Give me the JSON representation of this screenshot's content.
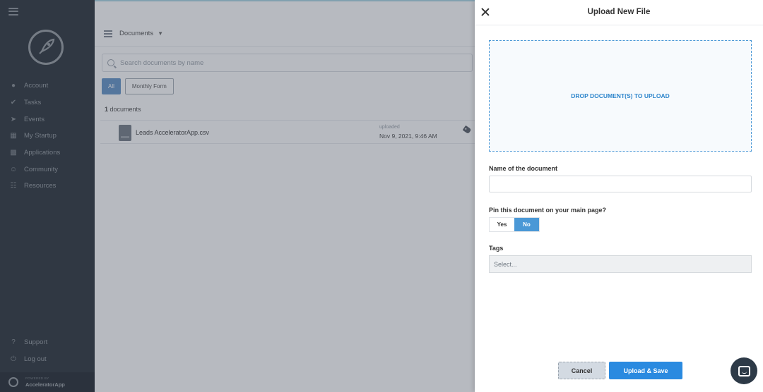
{
  "sidebar": {
    "nav": [
      {
        "label": "Account",
        "icon": "user-icon"
      },
      {
        "label": "Tasks",
        "icon": "check-circle-icon"
      },
      {
        "label": "Events",
        "icon": "rocket-icon"
      },
      {
        "label": "My Startup",
        "icon": "building-icon"
      },
      {
        "label": "Applications",
        "icon": "org-chart-icon"
      },
      {
        "label": "Community",
        "icon": "people-icon"
      },
      {
        "label": "Resources",
        "icon": "library-icon"
      }
    ],
    "bottom": [
      {
        "label": "Support",
        "icon": "question-circle-icon"
      },
      {
        "label": "Log out",
        "icon": "power-icon"
      }
    ],
    "powered": {
      "small": "POWERED BY",
      "brand": "AcceleratorApp"
    }
  },
  "main": {
    "header_title": "Documents",
    "search_placeholder": "Search documents by name",
    "filters": [
      "All",
      "Monthly Form"
    ],
    "count_number": "1",
    "count_label": "documents",
    "file": {
      "name": "Leads AcceleratorApp.csv",
      "uploaded_label": "uploaded",
      "uploaded_date": "Nov 9, 2021, 9:46 AM"
    }
  },
  "panel": {
    "title": "Upload New File",
    "drop_text": "DROP DOCUMENT(S) TO UPLOAD",
    "name_label": "Name of the document",
    "name_value": "",
    "pin_label": "Pin this document on your main page?",
    "pin_yes": "Yes",
    "pin_no": "No",
    "pin_selected": "No",
    "tags_label": "Tags",
    "tags_placeholder": "Select...",
    "cancel": "Cancel",
    "save": "Upload & Save"
  },
  "colors": {
    "sidebar_bg": "#1f2a35",
    "accent": "#2a8ae0",
    "toggle_active": "#4a98d6"
  }
}
